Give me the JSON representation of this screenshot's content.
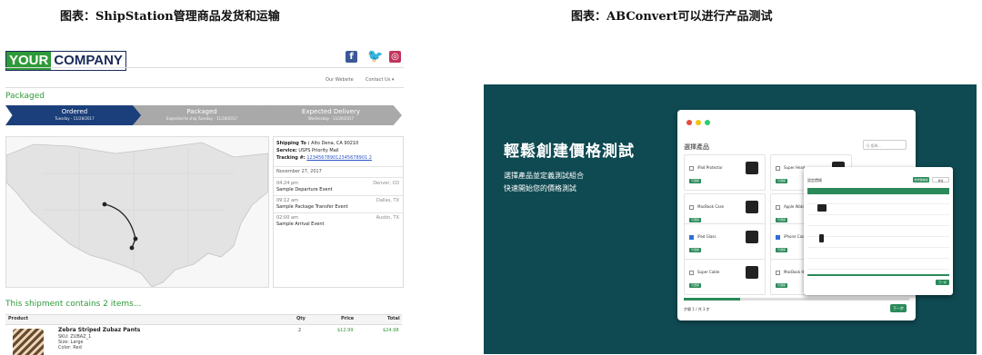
{
  "captions": {
    "left": "图表：ShipStation管理商品发货和运输",
    "right": "图表：ABConvert可以进行产品测试"
  },
  "shipstation": {
    "logo_left": "YOUR",
    "logo_right": "COMPANY",
    "links": [
      "Our Website",
      "Contact Us ▾"
    ],
    "status_title": "Packaged",
    "steps": [
      {
        "label": "Ordered",
        "sub": "Tuesday - 11/28/2017"
      },
      {
        "label": "Packaged",
        "sub": "Expected to ship Tuesday - 11/28/2017"
      },
      {
        "label": "Expected Delivery",
        "sub": "Wednesday - 11/29/2017"
      }
    ],
    "shipping_to_label": "Shipping To :",
    "shipping_to": "Alto Dena, CA 90210",
    "service_label": "Service:",
    "service": "USPS Priority Mail",
    "tracking_label": "Tracking #:",
    "tracking": "123456789012345678901 2",
    "date": "November 27, 2017",
    "events": [
      {
        "time": "04:24 pm",
        "desc": "Sample Departure Event",
        "place": "Denver, CO"
      },
      {
        "time": "09:12 am",
        "desc": "Sample Package Transfer Event",
        "place": "Dallas, TX"
      },
      {
        "time": "02:00 am",
        "desc": "Sample Arrival Event",
        "place": "Austin, TX"
      }
    ],
    "shipment_title": "This shipment contains 2 items...",
    "table_headers": [
      "Product",
      "Qty",
      "Price",
      "Total"
    ],
    "item": {
      "name": "Zebra Striped Zubaz Pants",
      "sku": "SKU: ZUBAZ_1",
      "size": "Size: Large",
      "color": "Color: Red",
      "qty": "2",
      "price": "$12.99",
      "total": "$24.98"
    },
    "colors": {
      "brand_green": "#2f9a3a",
      "brand_navy": "#1b3f7a"
    }
  },
  "abconvert": {
    "title": "輕鬆創建價格測試",
    "sub1": "選擇產品並定義測試組合",
    "sub2": "快速開始您的價格測試",
    "window_title": "選擇產品",
    "search_placeholder": "Q 搜尋...",
    "products": [
      {
        "name": "iPad Protector",
        "checked": false
      },
      {
        "name": "Super Head",
        "checked": false
      },
      {
        "name": "MacBook Case",
        "checked": false
      },
      {
        "name": "Apple Watch",
        "checked": false
      },
      {
        "name": "iPad Glass",
        "checked": true
      },
      {
        "name": "iPhone Case",
        "checked": true
      },
      {
        "name": "Super Cable",
        "checked": false
      },
      {
        "name": "MacBook Hub",
        "checked": false
      }
    ],
    "tag": "可選擇",
    "step_text": "步驟 1 / 共 3 步",
    "next_button": "下一步",
    "settings_title": "設定價格",
    "settings_buttons": [
      "新增價格組",
      "重設"
    ],
    "settings_ok": "下一步",
    "colors": {
      "bg": "#0f4a52",
      "accent": "#2a8a5a"
    }
  }
}
